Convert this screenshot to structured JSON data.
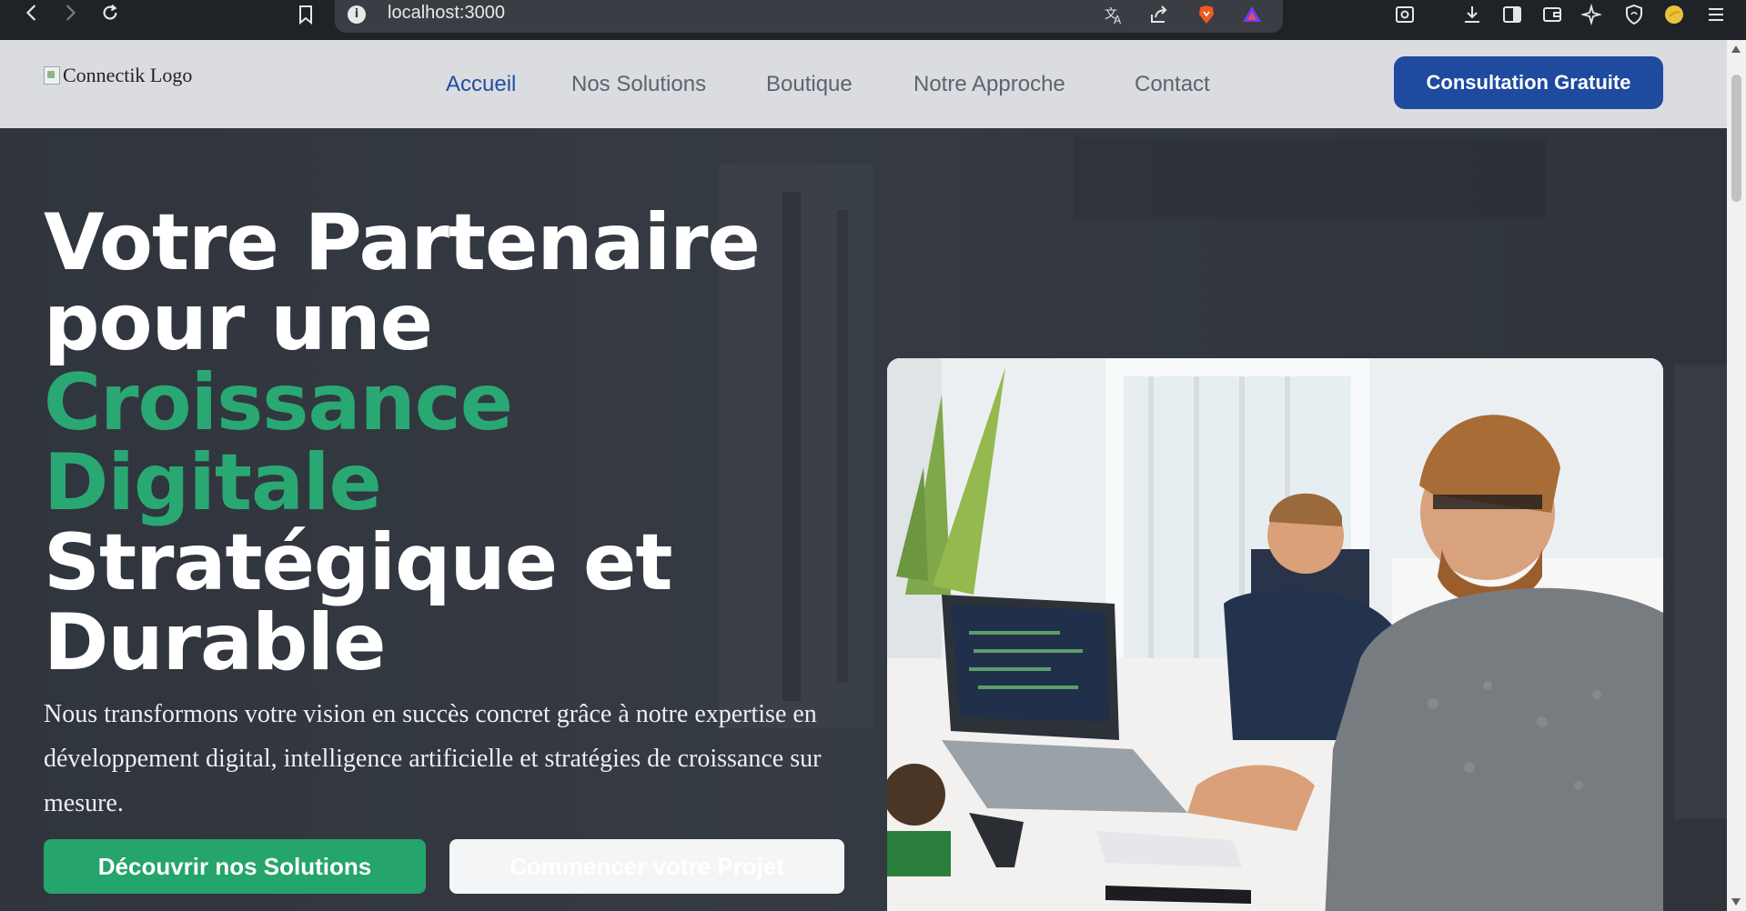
{
  "browser": {
    "url": "localhost:3000"
  },
  "header": {
    "logo_alt": "Connectik Logo",
    "nav": [
      {
        "label": "Accueil",
        "active": true
      },
      {
        "label": "Nos Solutions",
        "active": false
      },
      {
        "label": "Boutique",
        "active": false
      },
      {
        "label": "Notre Approche",
        "active": false
      },
      {
        "label": "Contact",
        "active": false
      }
    ],
    "cta_label": "Consultation Gratuite"
  },
  "hero": {
    "title_lines": [
      "Votre Partenaire",
      "pour une",
      "Croissance",
      "Digitale",
      "Stratégique et",
      "Durable"
    ],
    "description": "Nous transformons votre vision en succès concret grâce à notre expertise en développement digital, intelligence artificielle et stratégies de croissance sur mesure.",
    "primary_button": "Découvrir nos Solutions",
    "secondary_button": "Commencer votre Projet"
  },
  "colors": {
    "accent_green": "#2aa873",
    "brand_blue": "#1e4aa0",
    "hero_bg": "#30353d"
  },
  "icons": [
    "back-icon",
    "forward-icon",
    "reload-icon",
    "bookmark-icon",
    "info-icon",
    "translate-icon",
    "share-icon",
    "brave-icon",
    "triangle-icon",
    "screenshot-icon",
    "download-icon",
    "sidebar-icon",
    "wallet-icon",
    "ai-icon",
    "shield-icon",
    "profile-icon",
    "menu-icon"
  ]
}
